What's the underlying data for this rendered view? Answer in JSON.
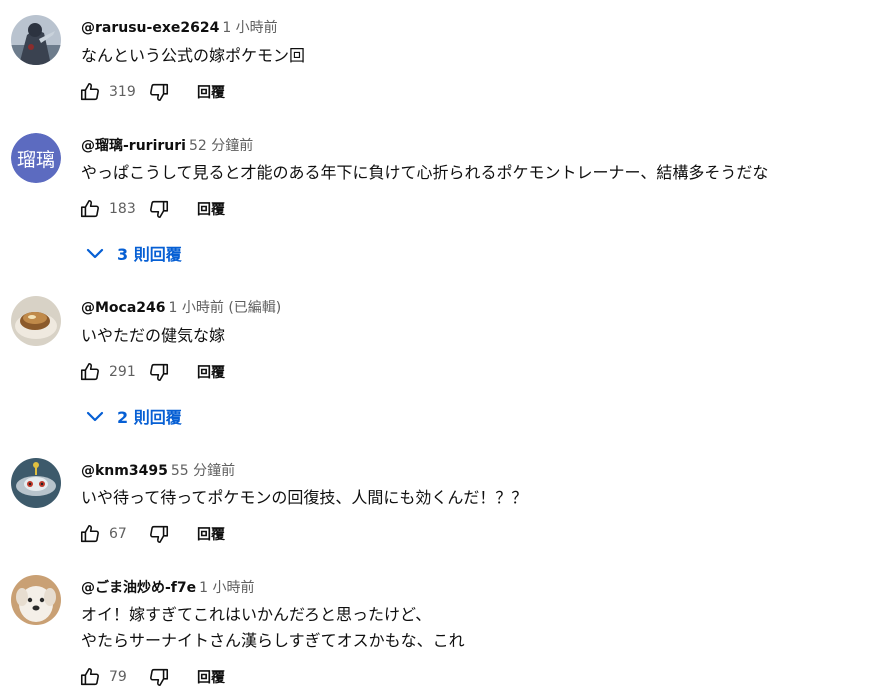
{
  "comments": [
    {
      "author": "@rarusu-exe2624",
      "time": "1 小時前",
      "lines": [
        "なんという公式の嫁ポケモン回"
      ],
      "likes": "319",
      "reply_label": "回覆"
    },
    {
      "author": "@瑠璃-ruriruri",
      "time": "52 分鐘前",
      "avatar_text": "瑠璃",
      "lines": [
        "やっぱこうして見ると才能のある年下に負けて心折られるポケモントレーナー、結構多そうだな"
      ],
      "likes": "183",
      "reply_label": "回覆",
      "replies_toggle": "3 則回覆"
    },
    {
      "author": "@Moca246",
      "time": "1 小時前 (已編輯)",
      "lines": [
        "いやただの健気な嫁"
      ],
      "likes": "291",
      "reply_label": "回覆",
      "replies_toggle": "2 則回覆"
    },
    {
      "author": "@knm3495",
      "time": "55 分鐘前",
      "lines": [
        "いや待って待ってポケモンの回復技、人間にも効くんだ！？？"
      ],
      "likes": "67",
      "reply_label": "回覆"
    },
    {
      "author": "@ごま油炒め-f7e",
      "time": "1 小時前",
      "lines": [
        "オイ！嫁すぎてこれはいかんだろと思ったけど、",
        "やたらサーナイトさん漢らしすぎてオスかもな、これ"
      ],
      "likes": "79",
      "reply_label": "回覆"
    }
  ],
  "colors": {
    "link": "#065fd4",
    "meta": "#606060",
    "avatar_text_bg": "#5c6bc0"
  },
  "icons": {
    "like": "thumb-up-outline",
    "dislike": "thumb-down-outline",
    "expand": "chevron-down"
  }
}
